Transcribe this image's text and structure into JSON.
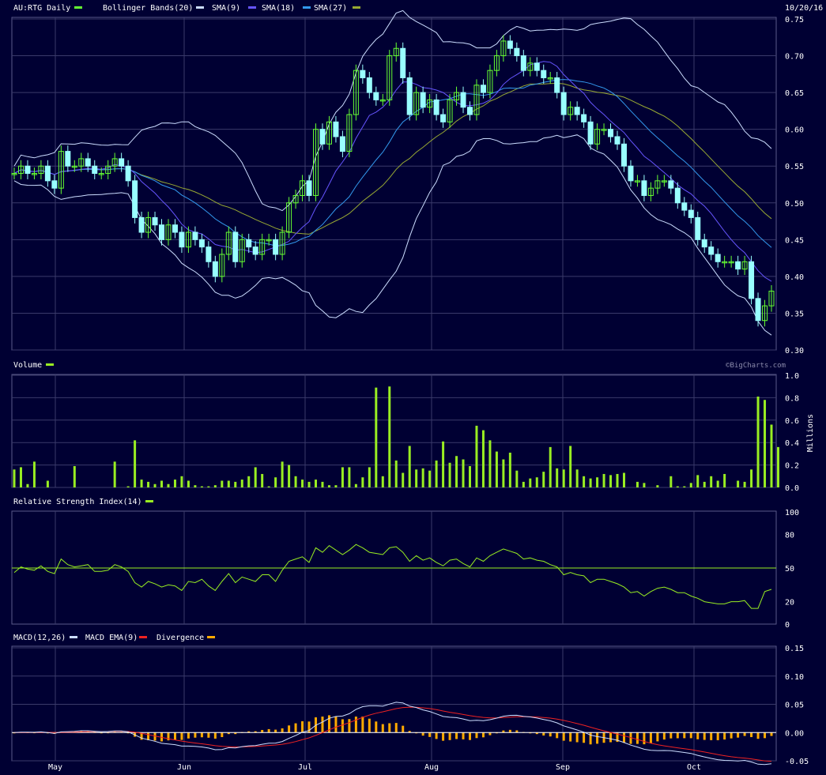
{
  "header": {
    "symbol_label": "AU:RTG Daily",
    "bb_label": "Bollinger Bands(20)",
    "sma9_label": "SMA(9)",
    "sma18_label": "SMA(18)",
    "sma27_label": "SMA(27)",
    "date": "10/20/16"
  },
  "watermark": "©BigCharts.com",
  "colors": {
    "background": "#000033",
    "up_candle": "#66ff33",
    "down_candle": "#99ffff",
    "bollinger": "#ccddff",
    "sma9": "#6655ff",
    "sma18": "#3399ee",
    "sma27": "#99aa33",
    "volume": "#99ee22",
    "rsi": "#99ee22",
    "macd": "#ccddff",
    "macd_ema": "#ee2222",
    "divergence": "#ffaa00"
  },
  "months": [
    "May",
    "Jun",
    "Jul",
    "Aug",
    "Sep",
    "Oct"
  ],
  "chart_data": [
    {
      "type": "candlestick",
      "title": "AU:RTG Daily",
      "y_ticks": [
        "0.75",
        "0.70",
        "0.65",
        "0.60",
        "0.55",
        "0.50",
        "0.45",
        "0.40",
        "0.35",
        "0.30"
      ],
      "ylim": [
        0.3,
        0.75
      ],
      "series_names": [
        "Bollinger Bands(20)",
        "SMA(9)",
        "SMA(18)",
        "SMA(27)"
      ],
      "close": [
        0.54,
        0.55,
        0.54,
        0.54,
        0.55,
        0.53,
        0.52,
        0.57,
        0.55,
        0.55,
        0.56,
        0.55,
        0.54,
        0.54,
        0.55,
        0.56,
        0.55,
        0.53,
        0.48,
        0.46,
        0.48,
        0.47,
        0.45,
        0.47,
        0.46,
        0.44,
        0.46,
        0.45,
        0.44,
        0.42,
        0.4,
        0.43,
        0.46,
        0.42,
        0.45,
        0.44,
        0.43,
        0.45,
        0.45,
        0.43,
        0.46,
        0.5,
        0.51,
        0.53,
        0.51,
        0.6,
        0.58,
        0.61,
        0.59,
        0.57,
        0.62,
        0.68,
        0.67,
        0.65,
        0.64,
        0.64,
        0.7,
        0.71,
        0.67,
        0.62,
        0.65,
        0.63,
        0.64,
        0.62,
        0.61,
        0.64,
        0.65,
        0.63,
        0.62,
        0.66,
        0.65,
        0.68,
        0.7,
        0.72,
        0.71,
        0.7,
        0.68,
        0.69,
        0.68,
        0.67,
        0.67,
        0.65,
        0.62,
        0.63,
        0.62,
        0.61,
        0.58,
        0.6,
        0.6,
        0.59,
        0.58,
        0.55,
        0.53,
        0.53,
        0.51,
        0.52,
        0.53,
        0.53,
        0.52,
        0.5,
        0.49,
        0.48,
        0.45,
        0.44,
        0.43,
        0.42,
        0.42,
        0.42,
        0.41,
        0.42,
        0.37,
        0.34,
        0.36,
        0.38
      ]
    },
    {
      "type": "bar",
      "title": "Volume",
      "ylabel": "Millions",
      "y_ticks": [
        "1.0",
        "0.8",
        "0.6",
        "0.4",
        "0.2",
        "0.0"
      ],
      "ylim": [
        0,
        1.0
      ],
      "values": [
        0.16,
        0.18,
        0.03,
        0.23,
        0.0,
        0.06,
        0.0,
        0.0,
        0.0,
        0.19,
        0.0,
        0.0,
        0.0,
        0.0,
        0.0,
        0.23,
        0.0,
        0.01,
        0.42,
        0.07,
        0.05,
        0.03,
        0.06,
        0.03,
        0.07,
        0.1,
        0.06,
        0.02,
        0.01,
        0.01,
        0.02,
        0.06,
        0.06,
        0.05,
        0.07,
        0.1,
        0.18,
        0.12,
        0.01,
        0.09,
        0.23,
        0.2,
        0.1,
        0.07,
        0.05,
        0.07,
        0.05,
        0.02,
        0.02,
        0.18,
        0.18,
        0.03,
        0.09,
        0.18,
        0.89,
        0.1,
        0.9,
        0.24,
        0.13,
        0.37,
        0.16,
        0.17,
        0.15,
        0.24,
        0.41,
        0.22,
        0.28,
        0.25,
        0.19,
        0.55,
        0.51,
        0.42,
        0.32,
        0.25,
        0.31,
        0.15,
        0.05,
        0.08,
        0.09,
        0.14,
        0.36,
        0.17,
        0.16,
        0.37,
        0.16,
        0.1,
        0.08,
        0.09,
        0.12,
        0.11,
        0.12,
        0.13,
        0.0,
        0.05,
        0.04,
        0.0,
        0.02,
        0.0,
        0.1,
        0.01,
        0.01,
        0.04,
        0.11,
        0.05,
        0.1,
        0.06,
        0.12,
        0.0,
        0.06,
        0.05,
        0.16,
        0.81,
        0.78,
        0.56,
        0.36
      ]
    },
    {
      "type": "line",
      "title": "Relative Strength Index(14)",
      "series_names": [
        "Relative Strength Index(14)"
      ],
      "y_ticks": [
        "100",
        "80",
        "50",
        "20",
        "0"
      ],
      "ylim": [
        0,
        100
      ],
      "reference_line": 50,
      "values": [
        46,
        51,
        49,
        48,
        52,
        47,
        45,
        58,
        53,
        51,
        52,
        53,
        47,
        47,
        48,
        53,
        51,
        47,
        37,
        33,
        38,
        36,
        33,
        35,
        34,
        30,
        38,
        37,
        40,
        34,
        30,
        38,
        45,
        37,
        42,
        40,
        38,
        44,
        44,
        38,
        48,
        56,
        58,
        60,
        55,
        68,
        64,
        70,
        66,
        62,
        66,
        71,
        68,
        64,
        63,
        62,
        68,
        69,
        64,
        56,
        61,
        57,
        59,
        55,
        52,
        57,
        58,
        54,
        51,
        59,
        56,
        61,
        64,
        67,
        65,
        63,
        58,
        59,
        57,
        56,
        53,
        51,
        44,
        46,
        44,
        43,
        37,
        40,
        40,
        38,
        36,
        33,
        28,
        29,
        25,
        29,
        32,
        33,
        31,
        28,
        28,
        25,
        23,
        20,
        19,
        18,
        18,
        20,
        20,
        21,
        14,
        14,
        29,
        31
      ]
    },
    {
      "type": "line",
      "title": "MACD(12,26)",
      "series_names": [
        "MACD(12,26)",
        "MACD EMA(9)",
        "Divergence"
      ],
      "y_ticks": [
        "0.15",
        "0.10",
        "0.05",
        "0.00",
        "-0.05"
      ],
      "ylim": [
        -0.05,
        0.15
      ]
    }
  ]
}
